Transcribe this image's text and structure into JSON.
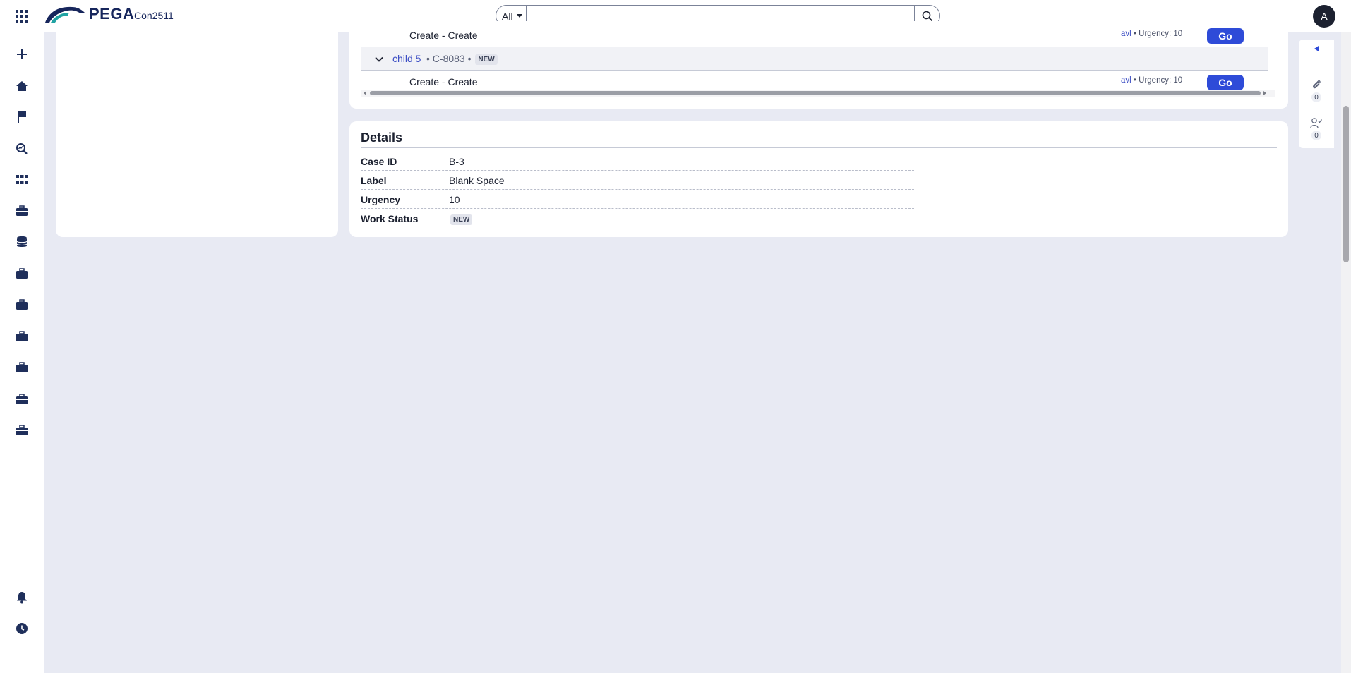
{
  "header": {
    "brand": "PEGA",
    "app_name": "Con2511",
    "search_scope": "All",
    "search_placeholder": "",
    "avatar_initial": "A"
  },
  "left_nav": {
    "icons": [
      "plus-icon",
      "home-icon",
      "flag-icon",
      "search-chart-icon",
      "apps-grid-icon",
      "briefcase-icon",
      "database-icon",
      "briefcase-icon",
      "briefcase-icon",
      "briefcase-icon",
      "briefcase-icon",
      "briefcase-icon",
      "briefcase-icon",
      "bell-icon",
      "clock-icon",
      "expand-icon"
    ]
  },
  "assignments": {
    "rows": [
      {
        "type": "task",
        "name": "Create - Create",
        "assignee": "avl",
        "separator": "•",
        "urgency": "Urgency: 10",
        "action": "Go"
      },
      {
        "type": "group",
        "link": "child 5",
        "meta": "• C-8083 •",
        "status": "NEW"
      },
      {
        "type": "task",
        "name": "Create - Create",
        "assignee": "avl",
        "separator": "•",
        "urgency": "Urgency: 10",
        "action": "Go"
      }
    ]
  },
  "details": {
    "title": "Details",
    "fields": [
      {
        "label": "Case ID",
        "value": "B-3"
      },
      {
        "label": "Label",
        "value": "Blank Space"
      },
      {
        "label": "Urgency",
        "value": "10"
      },
      {
        "label": "Work Status",
        "value": "NEW"
      }
    ]
  },
  "utility": {
    "attachments_count": "0",
    "followers_count": "0"
  },
  "colors": {
    "brand": "#17265c",
    "accent": "#2e4bd8",
    "link": "#3c4ec4",
    "background": "#e8eaf3"
  }
}
